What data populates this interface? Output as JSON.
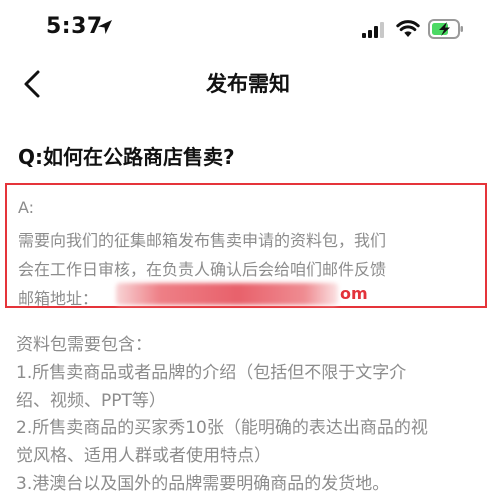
{
  "status_bar": {
    "time": "5:37",
    "icons": [
      "location-arrow-icon",
      "signal-icon",
      "wifi-icon",
      "battery-charging-icon"
    ]
  },
  "nav": {
    "back_icon": "chevron-left-icon",
    "title": "发布需知"
  },
  "faq": {
    "question": "Q:如何在公路商店售卖?",
    "answer_label": "A:",
    "answer_lines": [
      "需要向我们的征集邮箱发布售卖申请的资料包，我们",
      "会在工作日审核，在负责人确认后会给咱们邮件反馈",
      "邮箱地址："
    ],
    "email_visible_suffix": "om",
    "highlight_color": "#e5343a"
  },
  "requirements": {
    "heading": "资料包需要包含：",
    "lines": [
      "1.所售卖商品或者品牌的介绍（包括但不限于文字介",
      "绍、视频、PPT等）",
      "2.所售卖商品的买家秀10张（能明确的表达出商品的视",
      "觉风格、适用人群或者使用特点）",
      "3.港澳台以及国外的品牌需要明确商品的发货地。"
    ]
  }
}
